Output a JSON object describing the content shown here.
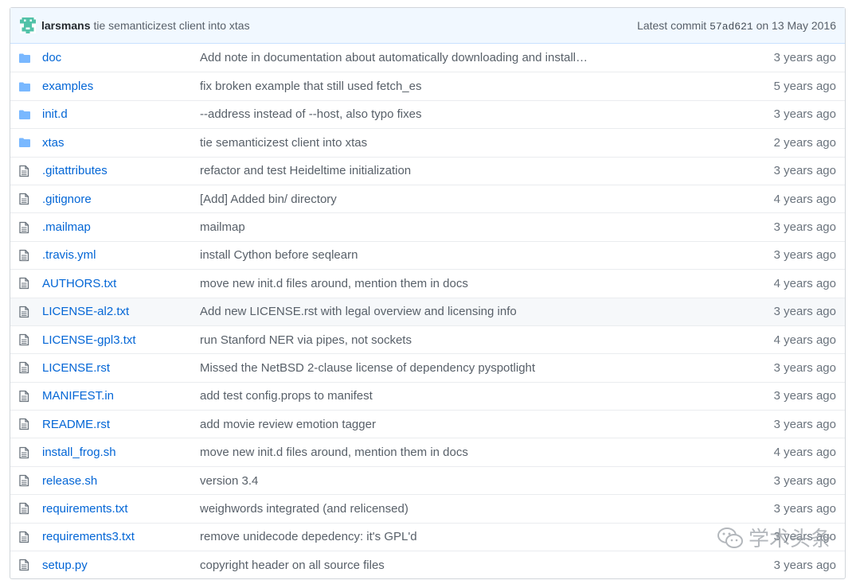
{
  "commit": {
    "author": "larsmans",
    "message": "tie semanticizest client into xtas",
    "latest_label": "Latest commit",
    "sha": "57ad621",
    "date": "on 13 May 2016"
  },
  "files": [
    {
      "name": "doc",
      "type": "folder",
      "message": "Add note in documentation about automatically downloading and install…",
      "age": "3 years ago"
    },
    {
      "name": "examples",
      "type": "folder",
      "message": "fix broken example that still used fetch_es",
      "age": "5 years ago"
    },
    {
      "name": "init.d",
      "type": "folder",
      "message": "--address instead of --host, also typo fixes",
      "age": "3 years ago"
    },
    {
      "name": "xtas",
      "type": "folder",
      "message": "tie semanticizest client into xtas",
      "age": "2 years ago"
    },
    {
      "name": ".gitattributes",
      "type": "file",
      "message": "refactor and test Heideltime initialization",
      "age": "3 years ago"
    },
    {
      "name": ".gitignore",
      "type": "file",
      "message": "[Add] Added bin/ directory",
      "age": "4 years ago"
    },
    {
      "name": ".mailmap",
      "type": "file",
      "message": "mailmap",
      "age": "3 years ago"
    },
    {
      "name": ".travis.yml",
      "type": "file",
      "message": "install Cython before seqlearn",
      "age": "3 years ago"
    },
    {
      "name": "AUTHORS.txt",
      "type": "file",
      "message": "move new init.d files around, mention them in docs",
      "age": "4 years ago"
    },
    {
      "name": "LICENSE-al2.txt",
      "type": "file",
      "message": "Add new LICENSE.rst with legal overview and licensing info",
      "age": "3 years ago"
    },
    {
      "name": "LICENSE-gpl3.txt",
      "type": "file",
      "message": "run Stanford NER via pipes, not sockets",
      "age": "4 years ago"
    },
    {
      "name": "LICENSE.rst",
      "type": "file",
      "message": "Missed the NetBSD 2-clause license of dependency pyspotlight",
      "age": "3 years ago"
    },
    {
      "name": "MANIFEST.in",
      "type": "file",
      "message": "add test config.props to manifest",
      "age": "3 years ago"
    },
    {
      "name": "README.rst",
      "type": "file",
      "message": "add movie review emotion tagger",
      "age": "3 years ago"
    },
    {
      "name": "install_frog.sh",
      "type": "file",
      "message": "move new init.d files around, mention them in docs",
      "age": "4 years ago"
    },
    {
      "name": "release.sh",
      "type": "file",
      "message": "version 3.4",
      "age": "3 years ago"
    },
    {
      "name": "requirements.txt",
      "type": "file",
      "message": "weighwords integrated (and relicensed)",
      "age": "3 years ago"
    },
    {
      "name": "requirements3.txt",
      "type": "file",
      "message": "remove unidecode depedency: it's GPL'd",
      "age": "3 years ago"
    },
    {
      "name": "setup.py",
      "type": "file",
      "message": "copyright header on all source files",
      "age": "3 years ago"
    }
  ],
  "highlight_row": 9,
  "watermark": {
    "text": "学术头条",
    "icon": "wechat-icon"
  },
  "colors": {
    "link": "#0366d6",
    "folder": "#79b8ff",
    "file_icon": "#6a737d",
    "tease_bg": "#f1f8ff"
  }
}
